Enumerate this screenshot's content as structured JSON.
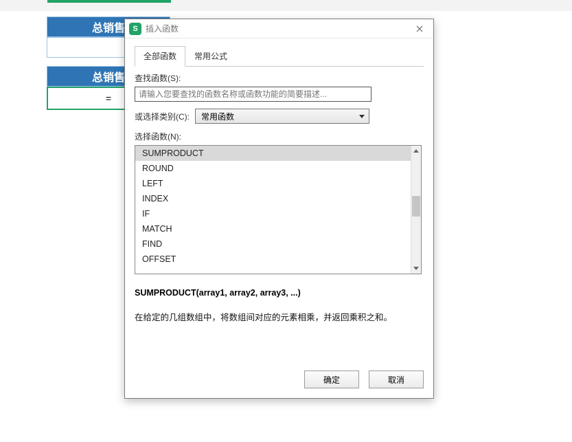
{
  "sheet": {
    "header1": "总销售",
    "header2": "总销售",
    "formula_cell": "="
  },
  "dialog": {
    "title": "插入函数",
    "tabs": {
      "all": "全部函数",
      "common": "常用公式"
    },
    "search_label": "查找函数(S):",
    "search_placeholder": "请输入您要查找的函数名称或函数功能的简要描述...",
    "category_label": "或选择类别(C):",
    "category_value": "常用函数",
    "list_label": "选择函数(N):",
    "functions": [
      "SUMPRODUCT",
      "ROUND",
      "LEFT",
      "INDEX",
      "IF",
      "MATCH",
      "FIND",
      "OFFSET"
    ],
    "signature": "SUMPRODUCT(array1, array2, array3, ...)",
    "description": "在给定的几组数组中，将数组间对应的元素相乘，并返回乘积之和。",
    "ok": "确定",
    "cancel": "取消"
  }
}
